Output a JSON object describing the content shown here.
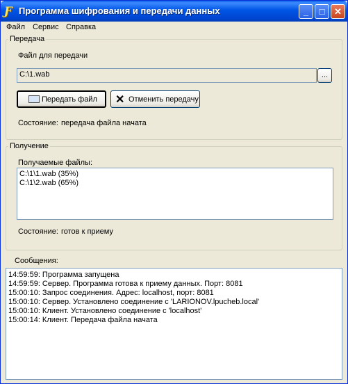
{
  "window": {
    "title": "Программа шифрования и передачи данных",
    "buttons": {
      "minimize": "_",
      "maximize": "□",
      "close": "✕"
    }
  },
  "menu": [
    "Файл",
    "Сервис",
    "Справка"
  ],
  "send_group": {
    "caption": "Передача",
    "file_label": "Файл для передачи",
    "file_value": "C:\\1.wab",
    "browse_label": "...",
    "send_button": "Передать файл",
    "cancel_button": "Отменить передачу",
    "status_label": "Состояние:",
    "status_value": "передача файла начата"
  },
  "receive_group": {
    "caption": "Получение",
    "files_label": "Получаемые файлы:",
    "files": [
      "C:\\1\\1.wab (35%)",
      "C:\\1\\2.wab (65%)"
    ],
    "status_label": "Состояние:",
    "status_value": "готов к приему"
  },
  "messages": {
    "caption": "Сообщения:",
    "items": [
      "14:59:59: Программа запущена",
      "14:59:59: Сервер. Программа готова к приему данных. Порт: 8081",
      "15:00:10: Запрос соединения. Адрес: localhost, порт: 8081",
      "15:00:10: Сервер. Установлено соединение с 'LARIONOV.lpucheb.local'",
      "15:00:10: Клиент. Установлено соединение с 'localhost'",
      "15:00:14: Клиент. Передача файла начата"
    ]
  }
}
